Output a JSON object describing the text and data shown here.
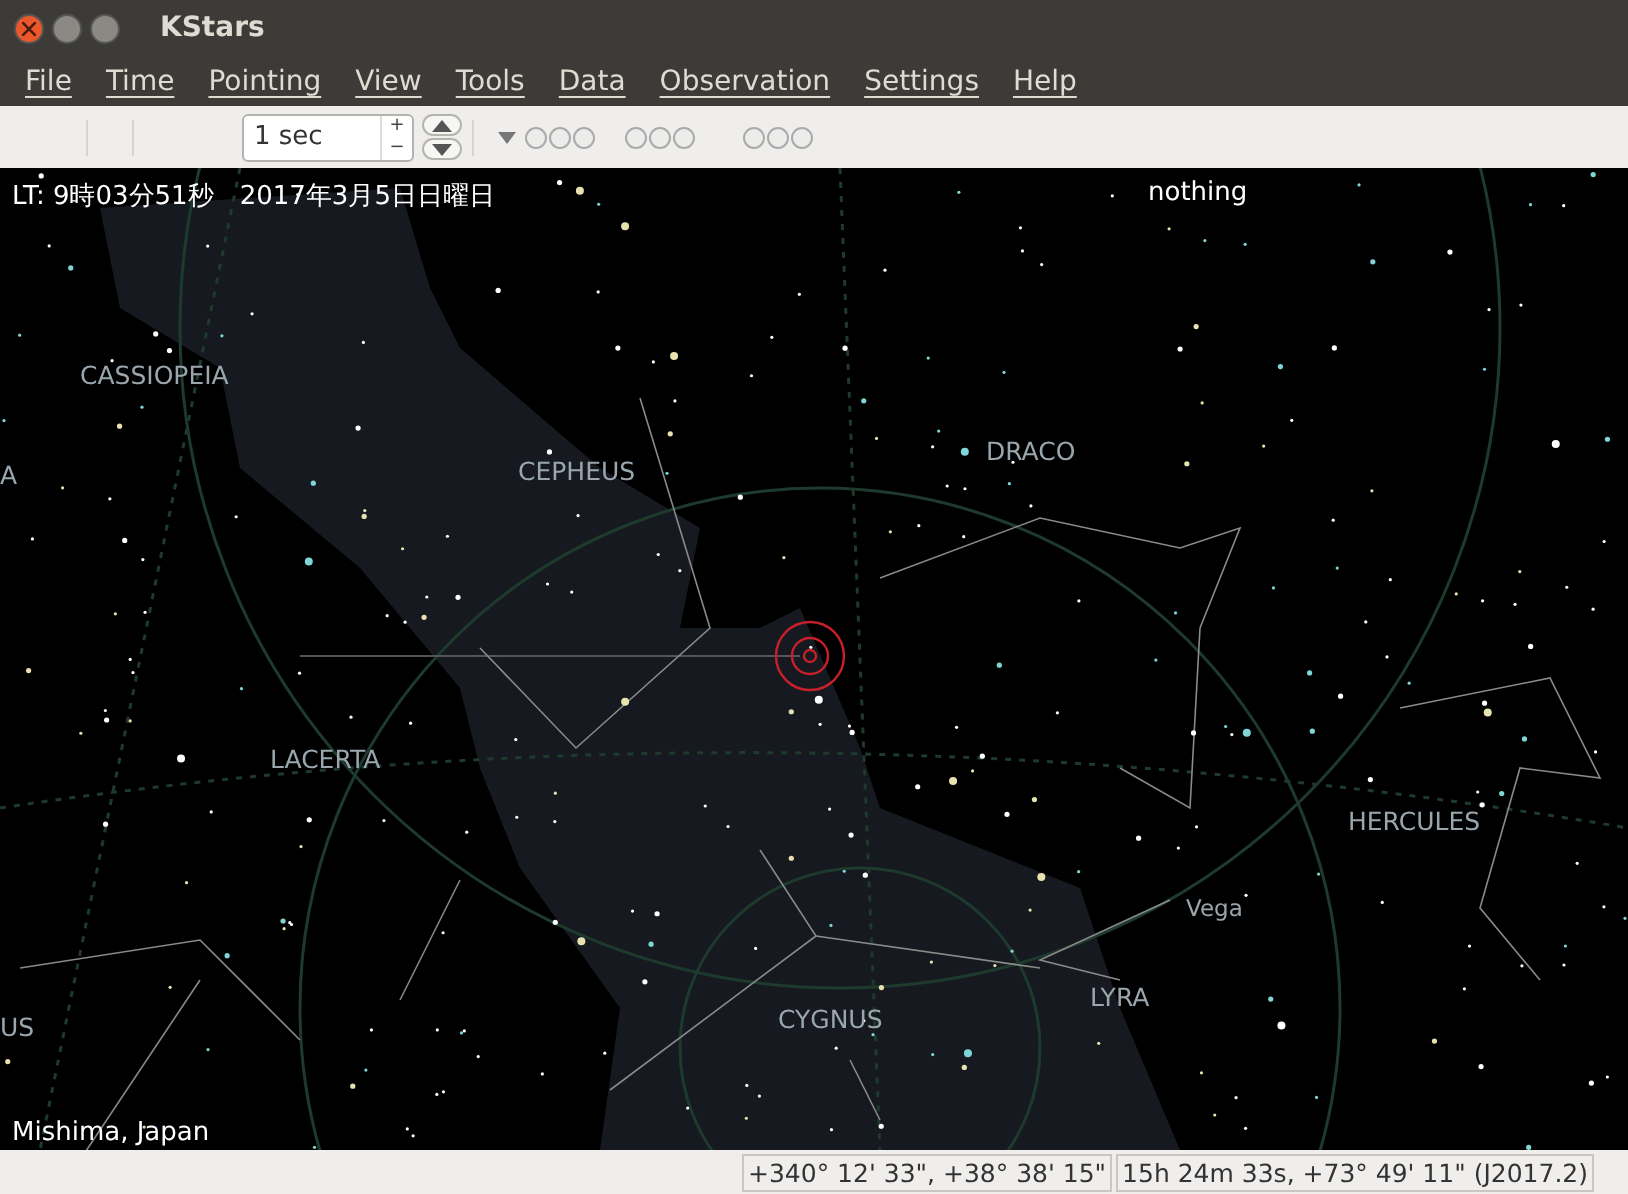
{
  "window": {
    "title": "KStars"
  },
  "menu": [
    {
      "label": "File"
    },
    {
      "label": "Time"
    },
    {
      "label": "Pointing"
    },
    {
      "label": "View"
    },
    {
      "label": "Tools"
    },
    {
      "label": "Data"
    },
    {
      "label": "Observation"
    },
    {
      "label": "Settings"
    },
    {
      "label": "Help"
    }
  ],
  "toolbar": {
    "time_step": "1 sec",
    "increment": "+",
    "decrement": "−"
  },
  "sky": {
    "clock": "LT: 9時03分51秒　2017年3月5日日曜日",
    "focus": "nothing",
    "location": "Mishima, Japan",
    "labels": [
      {
        "text": "CASSIOPEIA",
        "kind": "constellation"
      },
      {
        "text": "A",
        "kind": "constellation"
      },
      {
        "text": "CEPHEUS",
        "kind": "constellation"
      },
      {
        "text": "DRACO",
        "kind": "constellation"
      },
      {
        "text": "LACERTA",
        "kind": "constellation"
      },
      {
        "text": "HERCULES",
        "kind": "constellation"
      },
      {
        "text": "Vega",
        "kind": "star"
      },
      {
        "text": "LYRA",
        "kind": "constellation"
      },
      {
        "text": "CYGNUS",
        "kind": "constellation"
      },
      {
        "text": "US",
        "kind": "constellation"
      }
    ]
  },
  "status_bar": [
    "+340° 12' 33\", +38° 38' 15\"",
    "15h 24m 33s, +73° 49' 11\" (J2017.2)"
  ]
}
